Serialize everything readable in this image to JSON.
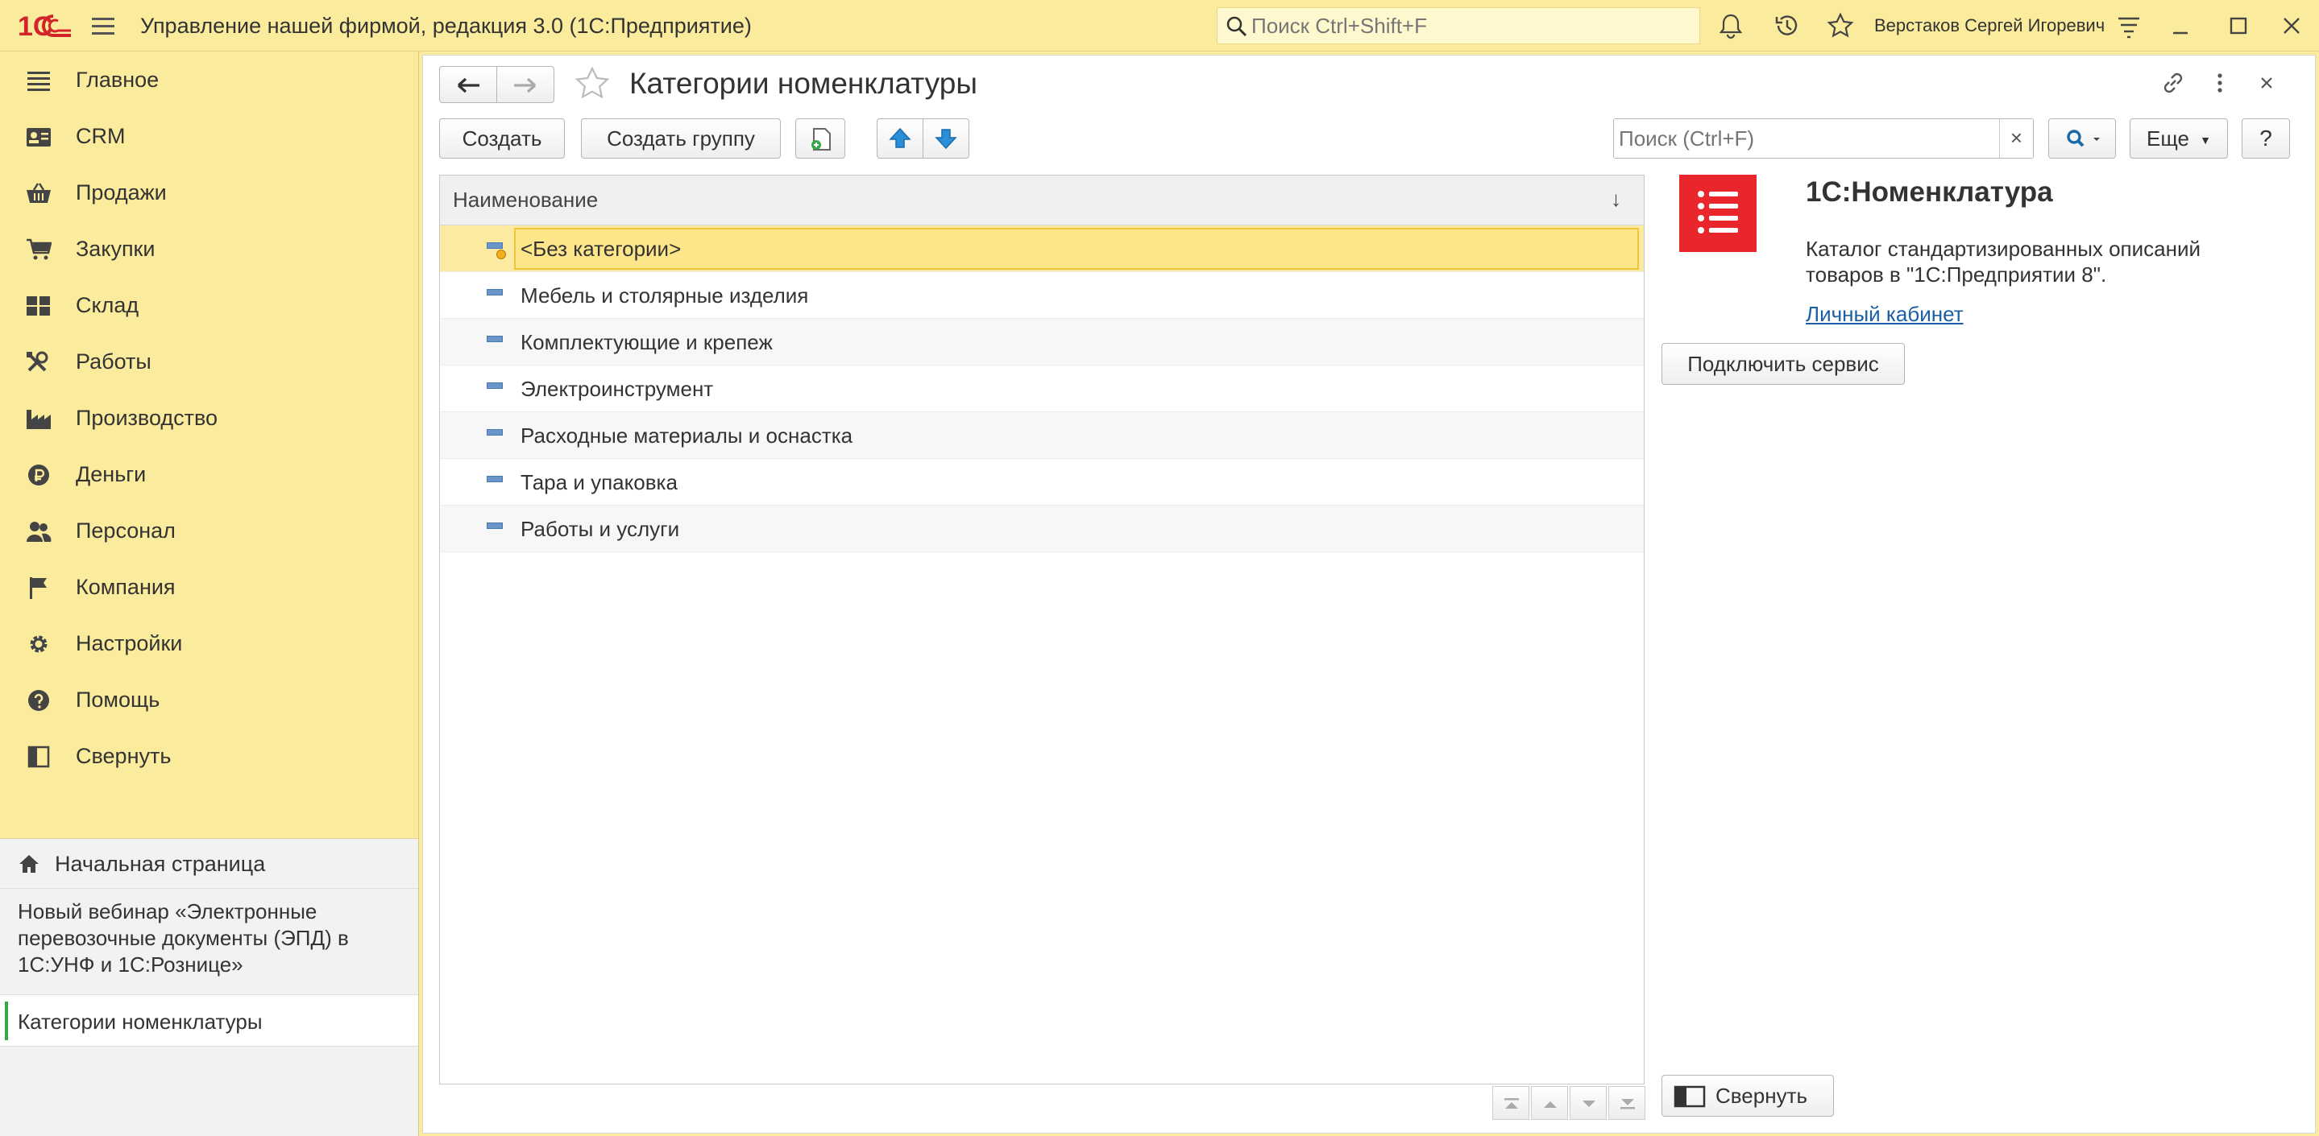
{
  "titlebar": {
    "app_title": "Управление нашей фирмой, редакция 3.0  (1С:Предприятие)",
    "search_placeholder": "Поиск Ctrl+Shift+F",
    "user_name": "Верстаков Сергей Игоревич"
  },
  "sidebar": {
    "items": [
      {
        "label": "Главное",
        "icon": "menu-list-icon"
      },
      {
        "label": "CRM",
        "icon": "contact-card-icon"
      },
      {
        "label": "Продажи",
        "icon": "basket-icon"
      },
      {
        "label": "Закупки",
        "icon": "cart-icon"
      },
      {
        "label": "Склад",
        "icon": "warehouse-icon"
      },
      {
        "label": "Работы",
        "icon": "tools-icon"
      },
      {
        "label": "Производство",
        "icon": "factory-icon"
      },
      {
        "label": "Деньги",
        "icon": "ruble-icon"
      },
      {
        "label": "Персонал",
        "icon": "people-icon"
      },
      {
        "label": "Компания",
        "icon": "flag-icon"
      },
      {
        "label": "Настройки",
        "icon": "gear-icon"
      },
      {
        "label": "Помощь",
        "icon": "help-icon"
      },
      {
        "label": "Свернуть",
        "icon": "collapse-panel-icon"
      }
    ],
    "home": "Начальная страница",
    "webinar": "Новый вебинар «Электронные перевозочные документы (ЭПД) в 1С:УНФ и 1С:Рознице»",
    "open_window": "Категории номенклатуры"
  },
  "form": {
    "title": "Категории номенклатуры",
    "buttons": {
      "create": "Создать",
      "create_group": "Создать группу",
      "more": "Еще",
      "help": "?"
    },
    "search_placeholder": "Поиск (Ctrl+F)",
    "clear": "×",
    "list": {
      "column": "Наименование",
      "sort_indicator": "↓",
      "rows": [
        {
          "label": "<Без категории>",
          "selected": true
        },
        {
          "label": "Мебель и столярные изделия"
        },
        {
          "label": "Комплектующие и крепеж"
        },
        {
          "label": "Электроинструмент"
        },
        {
          "label": "Расходные материалы и оснастка"
        },
        {
          "label": "Тара и упаковка"
        },
        {
          "label": "Работы и услуги"
        }
      ]
    },
    "info_panel": {
      "title": "1С:Номенклатура",
      "description": "Каталог стандартизированных описаний товаров в \"1С:Предприятии 8\".",
      "link": "Личный кабинет",
      "connect_button": "Подключить сервис",
      "collapse_button": "Свернуть"
    }
  },
  "colors": {
    "accent_yellow": "#fbec9d",
    "selection": "#fde58a",
    "logo_red": "#e8262b",
    "link_blue": "#1a5ea8",
    "active_bar": "#3aa64a"
  }
}
